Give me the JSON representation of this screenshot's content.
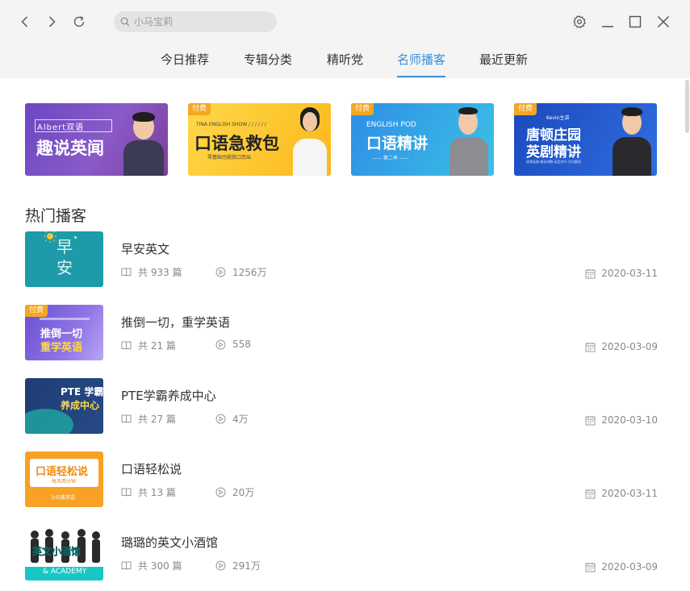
{
  "window": {
    "search_placeholder": "小马宝莉"
  },
  "icons": {
    "back": "chevron-left-icon",
    "forward": "chevron-right-icon",
    "refresh": "refresh-icon",
    "search": "search-icon",
    "settings": "gear-icon",
    "minimize": "minimize-icon",
    "maximize": "maximize-icon",
    "close": "close-icon",
    "episodes": "book-icon",
    "plays": "play-circle-icon",
    "date": "calendar-icon"
  },
  "tabs": [
    {
      "label": "今日推荐",
      "active": false
    },
    {
      "label": "专辑分类",
      "active": false
    },
    {
      "label": "精听党",
      "active": false
    },
    {
      "label": "名师播客",
      "active": true
    },
    {
      "label": "最近更新",
      "active": false
    }
  ],
  "banners": [
    {
      "paid": false,
      "line1": "Albert双语",
      "line2": "趣说英闻"
    },
    {
      "paid": true,
      "paid_label": "付费",
      "small": "TINA ENGLISH SHOW / / / / / /",
      "title": "口语急救包",
      "sub": "零基础也能脱口而出"
    },
    {
      "paid": true,
      "paid_label": "付费",
      "small": "ENGLISH POD",
      "title": "口语精讲",
      "sub": "—— 第二季 ——"
    },
    {
      "paid": true,
      "paid_label": "付费",
      "small": "Kevin主讲",
      "title1": "唐顿庄园",
      "title2": "英剧精讲",
      "sub": "经典英剧·精读讲解·英音技巧·文化解读"
    }
  ],
  "section": {
    "title": "热门播客"
  },
  "podcasts": [
    {
      "title": "早安英文",
      "episodes": "共 933 篇",
      "plays": "1256万",
      "date": "2020-03-11",
      "thumb_text": "早\n安",
      "paid": false
    },
    {
      "title": "推倒一切，重学英语",
      "episodes": "共 21 篇",
      "plays": "558",
      "date": "2020-03-09",
      "thumb_line1": "推倒一切",
      "thumb_line2": "重学英语",
      "paid": true,
      "paid_label": "付费"
    },
    {
      "title": "PTE学霸养成中心",
      "episodes": "共 27 篇",
      "plays": "4万",
      "date": "2020-03-10",
      "thumb_line1": "PTE 学霸",
      "thumb_line2": "养成中心",
      "paid": false
    },
    {
      "title": "口语轻松说",
      "episodes": "共 13 篇",
      "plays": "20万",
      "date": "2020-03-11",
      "thumb_line1": "口语轻松说",
      "thumb_line2": "每天两分钟",
      "thumb_line3": "沙拉酱英语",
      "paid": false
    },
    {
      "title": "璐璐的英文小酒馆",
      "episodes": "共 300 篇",
      "plays": "291万",
      "date": "2020-03-09",
      "thumb_line1": "英文小酒馆",
      "thumb_line2": "& ACADEMY",
      "paid": false
    }
  ]
}
